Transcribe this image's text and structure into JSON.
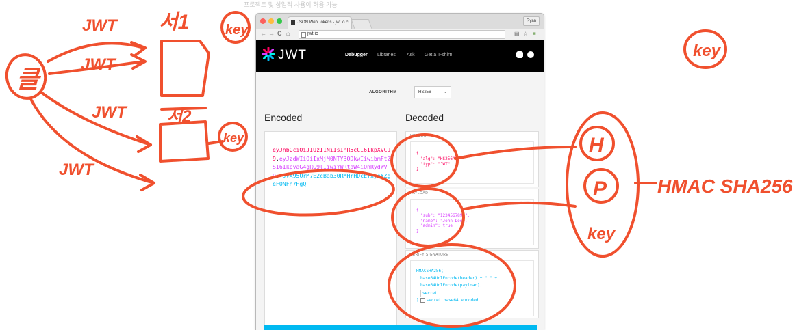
{
  "top_fade_text": "프로젝트 및 상업적 사용이 허용 가능",
  "browser": {
    "tab_title": "JSON Web Tokens - jwt.io",
    "tab_close": "×",
    "user": "Ryan",
    "url": "jwt.io",
    "nav_back": "←",
    "nav_forward": "→",
    "nav_reload": "C",
    "nav_home": "⌂",
    "right_icons": [
      "translate-icon",
      "star-icon",
      "menu-icon"
    ],
    "dot_colors": [
      "#fc605c",
      "#fdbc40",
      "#34c84a"
    ]
  },
  "site": {
    "logo": "JWT",
    "nav": [
      "Debugger",
      "Libraries",
      "Ask",
      "Get a T-shirt!"
    ],
    "header_icons": [
      "settings-icon",
      "twitter-icon"
    ]
  },
  "algorithm": {
    "label": "ALGORITHM",
    "value": "HS256"
  },
  "encoded": {
    "title": "Encoded",
    "header": "eyJhbGciOiJIUzI1NiIsInR5cCI6IkpXVCJ9",
    "dot1": ".",
    "payload": "eyJzdWIiOiIxMjM0NTY3ODkwIiwibmFtZSI6IkpvaG4gRG9lIiwiYWRtaW4iOnRydWV9",
    "dot2": ".",
    "signature": "TJVA95OrM7E2cBab30RMHrHDcEfxjoYZgeFONFh7HgQ"
  },
  "decoded": {
    "title": "Decoded",
    "header_label": "HEADER",
    "header_lines": [
      "{",
      "\"alg\": \"HS256\",",
      "\"typ\": \"JWT\"",
      "}"
    ],
    "payload_label": "PAYLOAD",
    "payload_lines": [
      "{",
      "\"sub\": \"1234567890\",",
      "\"name\": \"John Doe\",",
      "\"admin\": true",
      "}"
    ],
    "verify_label": "VERIFY SIGNATURE",
    "verify_lines": [
      "HMACSHA256(",
      "base64UrlEncode(header) + \".\" +",
      "base64UrlEncode(payload),"
    ],
    "secret_value": "secret",
    "verify_end": ")",
    "checkbox_label": "secret base64 encoded"
  },
  "annotations": {
    "left_circle": "클",
    "jwt_1": "JWT",
    "jwt_2": "JWT",
    "jwt_3": "JWT",
    "jwt_4": "JWT",
    "server_1": "서1",
    "server_2": "서2",
    "key_1": "key",
    "key_2": "key",
    "key_right": "key",
    "h": "H",
    "p": "P",
    "key_bottom": "key",
    "hmac": "HMAC SHA256"
  },
  "colors": {
    "accent": "#00b9f1",
    "header_red": "#fb015b",
    "payload_purple": "#d63aff",
    "ink": "#f0502e"
  }
}
